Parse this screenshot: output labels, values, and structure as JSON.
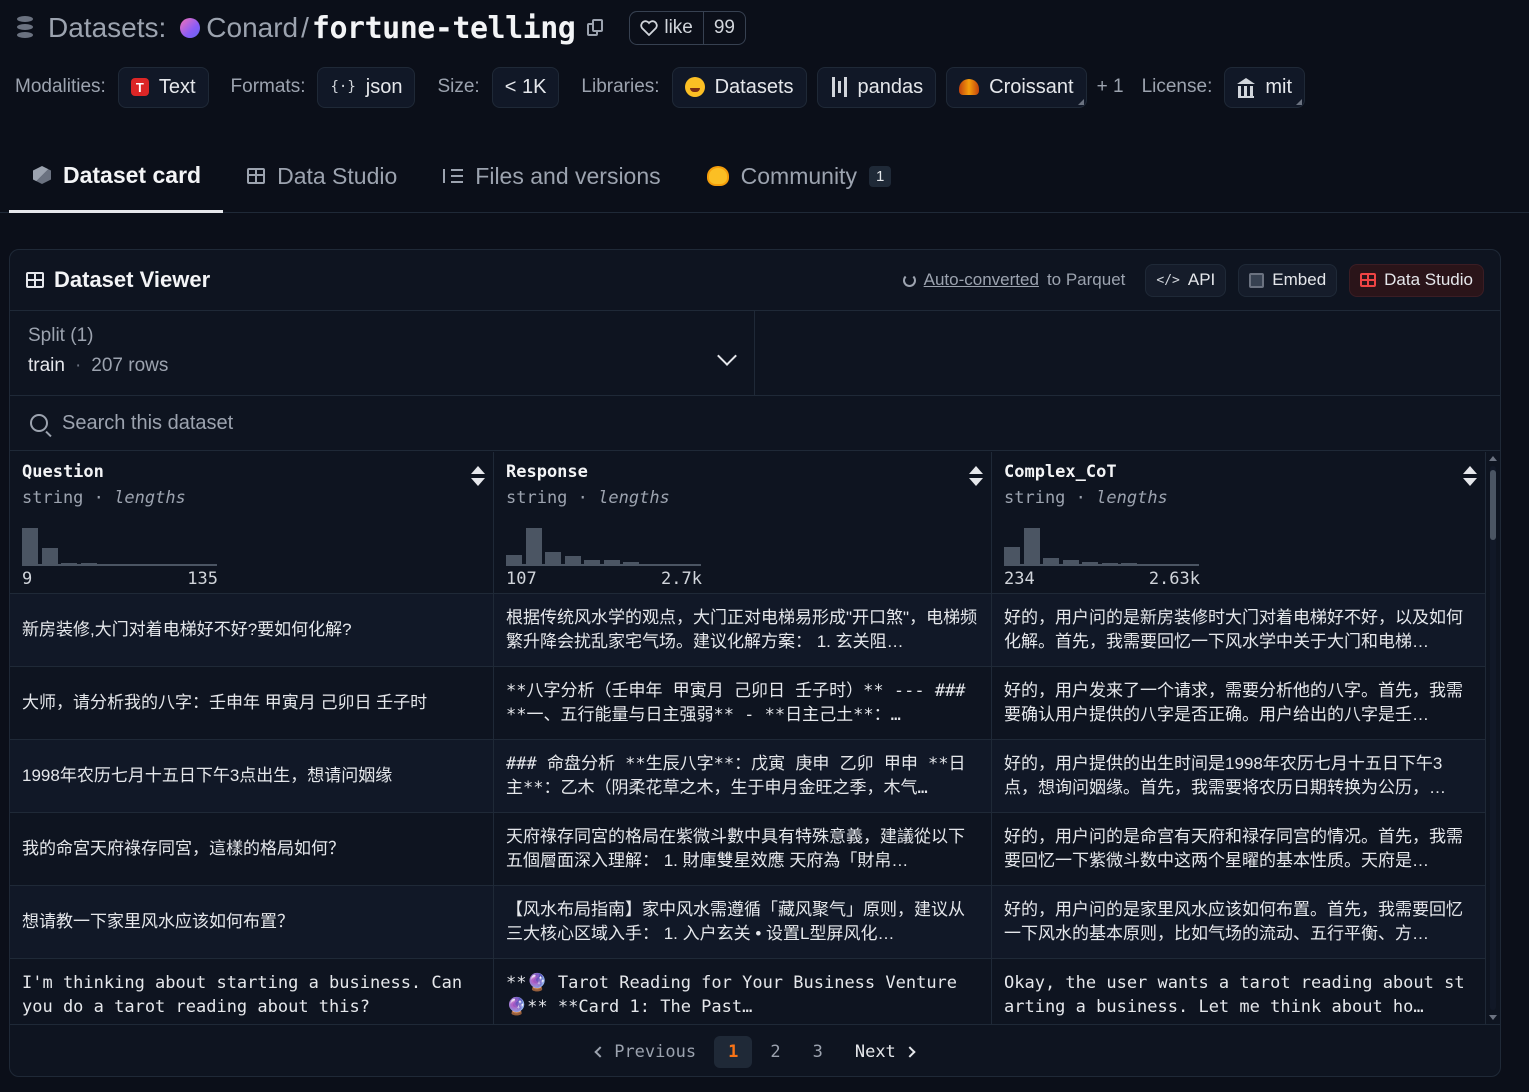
{
  "header": {
    "prefix": "Datasets:",
    "org": "Conard",
    "separator": "/",
    "repo": "fortune-telling",
    "like_label": "like",
    "like_count": "99"
  },
  "tags": {
    "modalities_label": "Modalities:",
    "modality": "Text",
    "formats_label": "Formats:",
    "format": "json",
    "size_label": "Size:",
    "size": "< 1K",
    "libraries_label": "Libraries:",
    "libraries": [
      "Datasets",
      "pandas",
      "Croissant"
    ],
    "libraries_more": "+ 1",
    "license_label": "License:",
    "license": "mit"
  },
  "tabs": [
    {
      "label": "Dataset card",
      "icon": "cube-icon",
      "active": true
    },
    {
      "label": "Data Studio",
      "icon": "table-icon"
    },
    {
      "label": "Files and versions",
      "icon": "files-icon"
    },
    {
      "label": "Community",
      "icon": "community-icon",
      "badge": "1"
    }
  ],
  "viewer": {
    "title": "Dataset Viewer",
    "auto_converted_link": "Auto-converted",
    "auto_converted_suffix": "to Parquet",
    "api_label": "API",
    "embed_label": "Embed",
    "studio_label": "Data Studio",
    "split_label": "Split (1)",
    "split_value": "train",
    "split_sep": "·",
    "split_rows": "207 rows",
    "search_placeholder": "Search this dataset"
  },
  "columns": [
    {
      "name": "Question",
      "type": "string",
      "sep": " · ",
      "stat": "lengths",
      "min": "9",
      "max": "135",
      "histogram": [
        0.9,
        0.42,
        0.07,
        0.07,
        0.05,
        0.05,
        0.05,
        0.05,
        0.05,
        0.05
      ]
    },
    {
      "name": "Response",
      "type": "string",
      "sep": " · ",
      "stat": "lengths",
      "min": "107",
      "max": "2.7k",
      "histogram": [
        0.26,
        0.9,
        0.33,
        0.23,
        0.14,
        0.14,
        0.09,
        0.05,
        0.05,
        0.05
      ]
    },
    {
      "name": "Complex_CoT",
      "type": "string",
      "sep": " · ",
      "stat": "lengths",
      "min": "234",
      "max": "2.63k",
      "histogram": [
        0.45,
        0.9,
        0.2,
        0.14,
        0.09,
        0.07,
        0.07,
        0.05,
        0.05,
        0.05
      ]
    }
  ],
  "rows": [
    [
      "新房装修,大门对着电梯好不好?要如何化解?",
      "根据传统风水学的观点，大门正对电梯易形成\"开口煞\"，电梯频繁升降会扰乱家宅气场。建议化解方案： 1. 玄关阻…",
      "好的，用户问的是新房装修时大门对着电梯好不好，以及如何化解。首先，我需要回忆一下风水学中关于大门和电梯…"
    ],
    [
      "大师，请分析我的八字：壬申年 甲寅月 己卯日 壬子时",
      "**八字分析（壬申年 甲寅月 己卯日 壬子时）** --- ### **一、五行能量与日主强弱** - **日主己土**：…",
      "好的，用户发来了一个请求，需要分析他的八字。首先，我需要确认用户提供的八字是否正确。用户给出的八字是壬…"
    ],
    [
      "1998年农历七月十五日下午3点出生，想请问姻缘",
      "### 命盘分析 **生辰八字**：戊寅 庚申 乙卯 甲申 **日主**：乙木（阴柔花草之木，生于申月金旺之季，木气…",
      "好的，用户提供的出生时间是1998年农历七月十五日下午3点，想询问姻缘。首先，我需要将农历日期转换为公历，…"
    ],
    [
      "我的命宮天府祿存同宮，這樣的格局如何？",
      "天府祿存同宮的格局在紫微斗數中具有特殊意義，建議從以下五個層面深入理解： 1. 財庫雙星效應 天府為「財帛…",
      "好的，用户问的是命宫有天府和禄存同宫的情况。首先，我需要回忆一下紫微斗数中这两个星曜的基本性质。天府是…"
    ],
    [
      "想请教一下家里风水应该如何布置？",
      "【风水布局指南】家中风水需遵循「藏风聚气」原则，建议从三大核心区域入手： 1. 入户玄关 • 设置L型屏风化…",
      "好的，用户问的是家里风水应该如何布置。首先，我需要回忆一下风水的基本原则，比如气场的流动、五行平衡、方…"
    ],
    [
      "I'm thinking about starting a business. Can you do a tarot reading about this?",
      "**🔮 Tarot Reading for Your Business Venture 🔮** **Card 1: The Past…",
      "Okay, the user wants a tarot reading about starting a business. Let me think about ho…"
    ]
  ],
  "pagination": {
    "previous": "Previous",
    "pages": [
      "1",
      "2",
      "3"
    ],
    "current": "1",
    "next": "Next"
  }
}
